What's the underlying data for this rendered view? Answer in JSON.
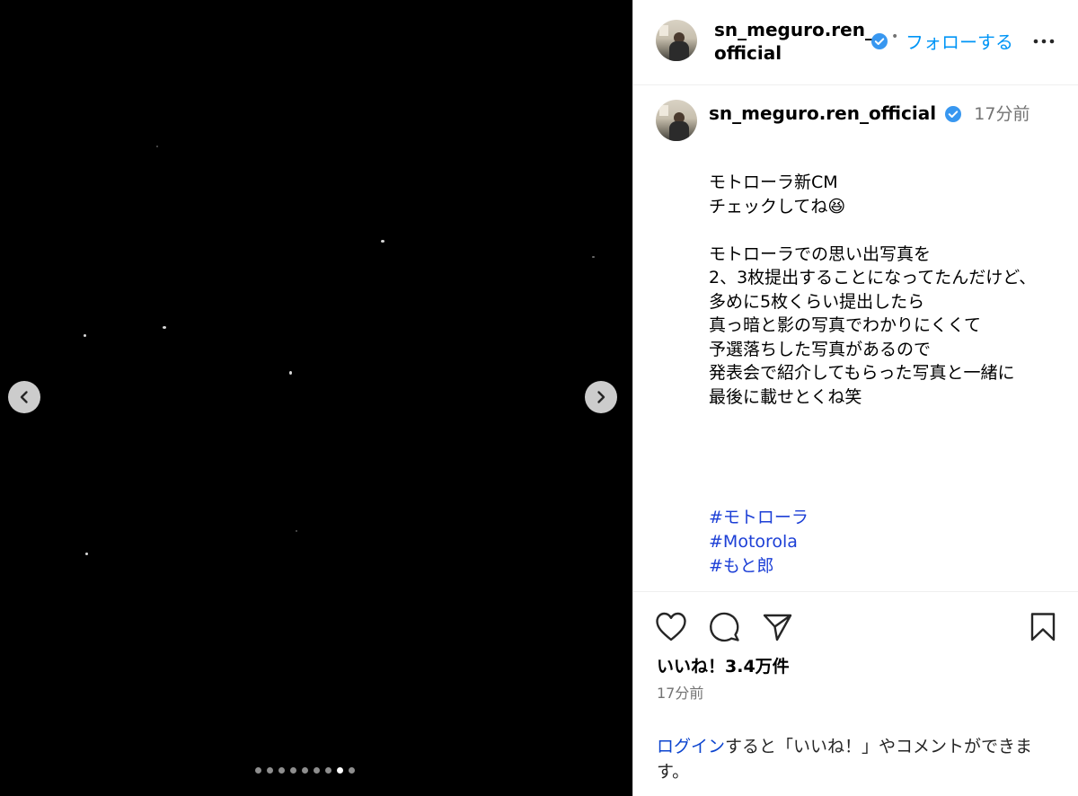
{
  "media": {
    "carousel_total": 9,
    "carousel_active_index": 7
  },
  "header": {
    "username_line1": "sn_meguro.ren_",
    "username_line2": "official",
    "separator": "•",
    "follow_label": "フォローする",
    "more_icon": "three-dots-icon"
  },
  "post": {
    "username": "sn_meguro.ren_official",
    "time": "17分前",
    "caption": "モトローラ新CM\nチェックしてね😆\n\nモトローラでの思い出写真を\n2、3枚提出することになってたんだけど、\n多めに5枚くらい提出したら\n真っ暗と影の写真でわかりにくくて\n予選落ちした写真があるので\n発表会で紹介してもらった写真と一緒に\n最後に載せとくね笑",
    "hashtags": [
      "#モトローラ",
      "#Motorola",
      "#もと郎"
    ]
  },
  "actions": {
    "like_icon": "heart-icon",
    "comment_icon": "comment-icon",
    "share_icon": "send-icon",
    "save_icon": "bookmark-icon"
  },
  "likes": "いいね！3.4万件",
  "post_date": "17分前",
  "login_prompt": {
    "link": "ログイン",
    "rest": "すると「いいね！」やコメントができます。"
  },
  "colors": {
    "link_blue": "#0095f6",
    "hashtag_blue": "#1c3fd6",
    "verified_blue": "#3897f0"
  }
}
